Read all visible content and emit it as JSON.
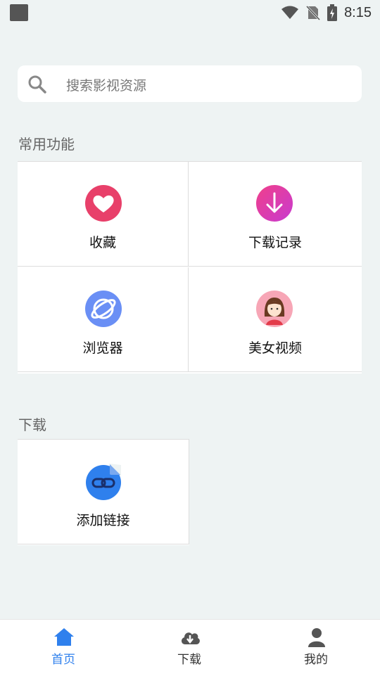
{
  "status_bar": {
    "time": "8:15"
  },
  "search": {
    "placeholder": "搜索影视资源"
  },
  "common_features": {
    "title": "常用功能",
    "items": [
      {
        "label": "收藏",
        "icon": "heart-icon"
      },
      {
        "label": "下载记录",
        "icon": "download-arrow-icon"
      },
      {
        "label": "浏览器",
        "icon": "planet-icon"
      },
      {
        "label": "美女视频",
        "icon": "girl-avatar-icon"
      }
    ]
  },
  "download_section": {
    "title": "下载",
    "items": [
      {
        "label": "添加链接",
        "icon": "link-icon"
      }
    ]
  },
  "tab_bar": {
    "tabs": [
      {
        "label": "首页",
        "icon": "home-icon",
        "active": true
      },
      {
        "label": "下载",
        "icon": "cloud-download-icon",
        "active": false
      },
      {
        "label": "我的",
        "icon": "user-icon",
        "active": false
      }
    ]
  },
  "colors": {
    "accent": "#2f80ed",
    "inactive": "#444444"
  }
}
